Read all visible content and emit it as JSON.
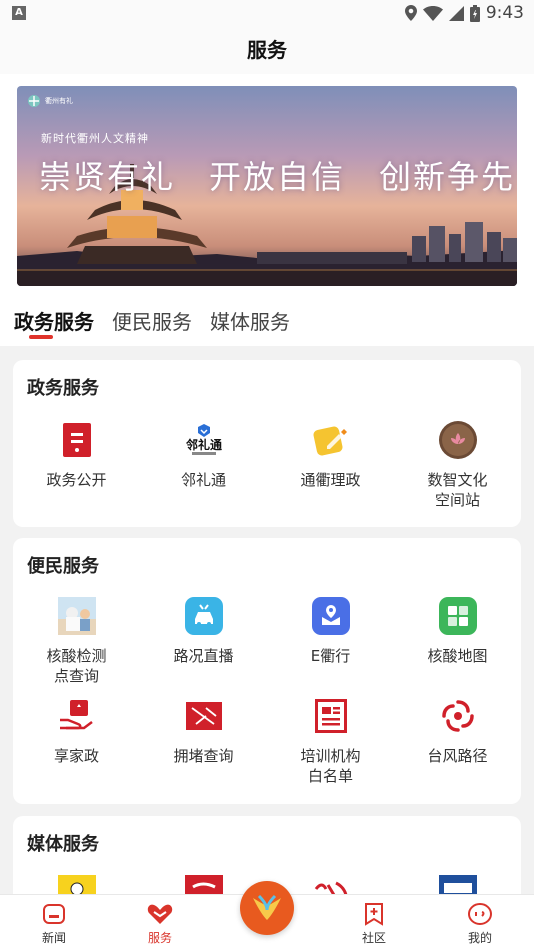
{
  "status_bar": {
    "time": "9:43",
    "left_badge": "A"
  },
  "header": {
    "title": "服务"
  },
  "banner": {
    "logo_text": "衢州有礼",
    "subtitle": "新时代衢州人文精神",
    "slogan": "崇贤有礼　开放自信　创新争先"
  },
  "tabs": [
    {
      "label": "政务服务",
      "active": true
    },
    {
      "label": "便民服务",
      "active": false
    },
    {
      "label": "媒体服务",
      "active": false
    }
  ],
  "sections": {
    "gov": {
      "title": "政务服务",
      "items": [
        {
          "label": "政务公开",
          "icon": "document-red-icon"
        },
        {
          "label": "邻礼通",
          "icon": "linlitong-logo-icon"
        },
        {
          "label": "通衢理政",
          "icon": "pencil-yellow-icon"
        },
        {
          "label": "数智文化\n空间站",
          "icon": "lotus-circle-icon"
        }
      ]
    },
    "life": {
      "title": "便民服务",
      "items": [
        {
          "label": "核酸检测\n点查询",
          "icon": "test-site-photo-icon"
        },
        {
          "label": "路况直播",
          "icon": "car-blue-icon"
        },
        {
          "label": "E衢行",
          "icon": "map-pin-blue-icon"
        },
        {
          "label": "核酸地图",
          "icon": "grid-green-icon"
        },
        {
          "label": "享家政",
          "icon": "hand-heart-icon"
        },
        {
          "label": "拥堵查询",
          "icon": "traffic-red-icon"
        },
        {
          "label": "培训机构\n白名单",
          "icon": "list-doc-icon"
        },
        {
          "label": "台风路径",
          "icon": "typhoon-icon"
        }
      ]
    },
    "media": {
      "title": "媒体服务",
      "items": [
        {
          "label": "",
          "icon": "comic-media-icon"
        },
        {
          "label": "",
          "icon": "red-calligraphy-media-icon"
        },
        {
          "label": "",
          "icon": "peoples-daily-icon"
        },
        {
          "label": "",
          "icon": "xinhua-icon"
        }
      ]
    }
  },
  "bottom_nav": [
    {
      "label": "新闻",
      "icon": "news-icon",
      "active": false
    },
    {
      "label": "服务",
      "icon": "heart-hands-icon",
      "active": true
    },
    {
      "label": "",
      "icon": "center-logo-icon",
      "active": false
    },
    {
      "label": "社区",
      "icon": "community-bookmark-icon",
      "active": false
    },
    {
      "label": "我的",
      "icon": "profile-icon",
      "active": false
    }
  ],
  "colors": {
    "accent": "#e0332b",
    "nav_active": "#d9342b",
    "center": "#e85a1f"
  }
}
